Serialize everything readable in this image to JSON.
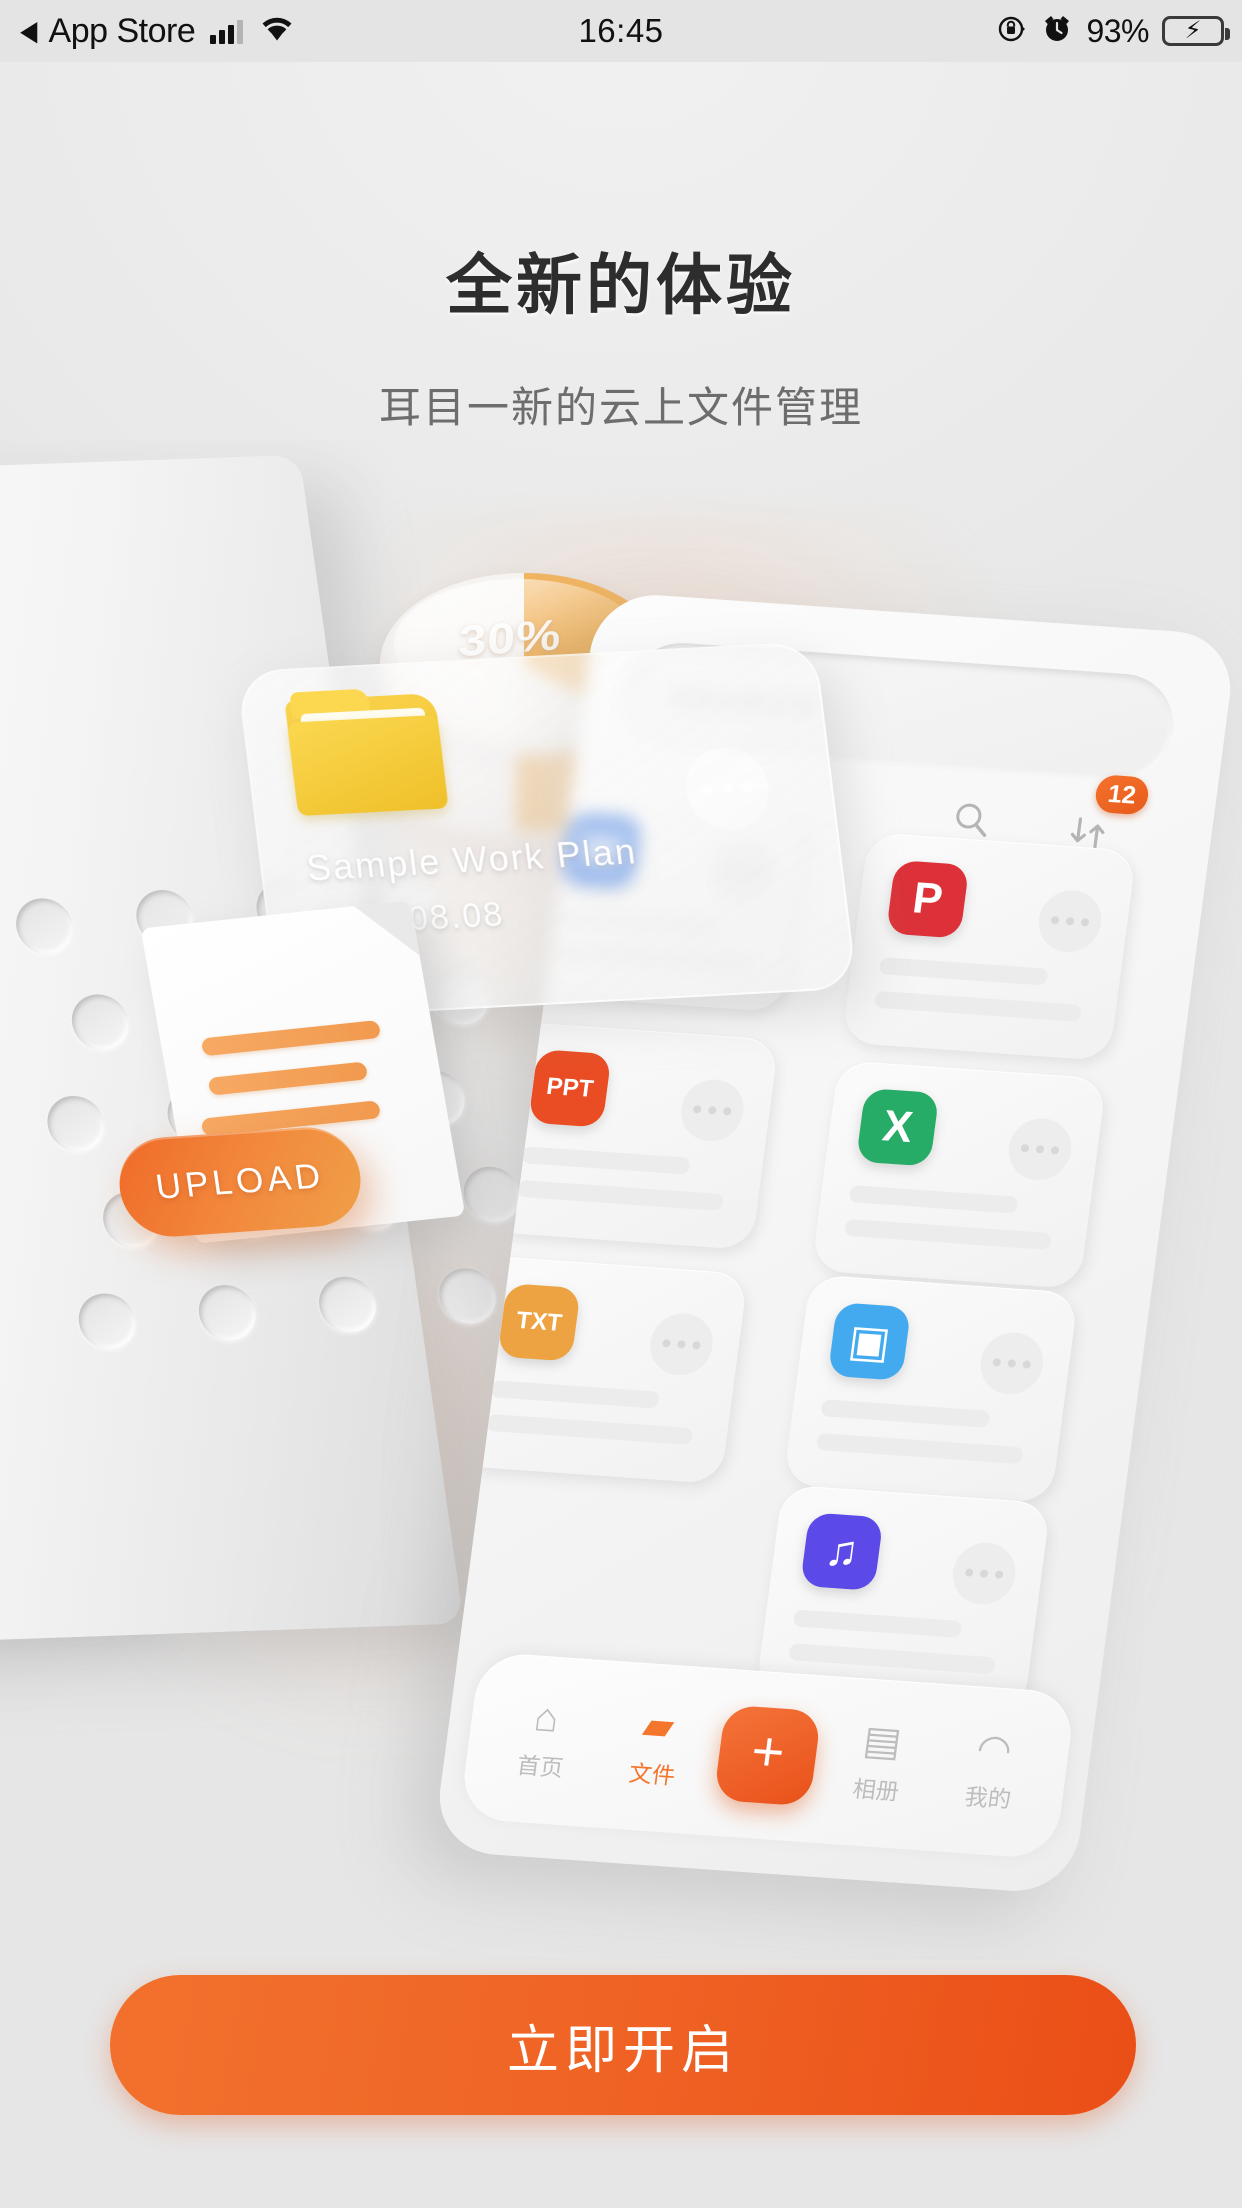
{
  "status_bar": {
    "back_label": "App Store",
    "back_icon": "triangle-left-icon",
    "signal_icon": "cellular-signal-icon",
    "wifi_icon": "wifi-icon",
    "time": "16:45",
    "rotation_lock_icon": "rotation-lock-icon",
    "alarm_icon": "alarm-clock-icon",
    "battery_percent": "93%",
    "battery_icon": "battery-charging-icon",
    "battery_level": 93,
    "charging_icon": "lightning-bolt-icon"
  },
  "header": {
    "title": "全新的体验",
    "subtitle": "耳目一新的云上文件管理"
  },
  "illustration": {
    "pie_chart": {
      "label": "30%",
      "value": 30,
      "slice_color": "#f3b45c"
    },
    "folder_card": {
      "name": "Sample Work Plan",
      "date": "2020.08.08",
      "folder_icon": "folder-icon",
      "more_icon": "more-dots-icon"
    },
    "document": {
      "doc_icon": "document-icon",
      "line_color": "#f4a05a"
    },
    "upload_button": {
      "label": "UPLOAD"
    },
    "phone": {
      "search": {
        "placeholder": "SEARCH",
        "search_icon": "magnifier-icon"
      },
      "sort": {
        "icon": "sort-icon",
        "badge": "12"
      },
      "tiles": [
        {
          "icon": "word-icon",
          "glyph": "W",
          "color": "#2b6fe0"
        },
        {
          "icon": "pdf-icon",
          "glyph": "P",
          "color": "#dc3138"
        },
        {
          "icon": "excel-icon",
          "glyph": "X",
          "color": "#27ac68"
        },
        {
          "icon": "ppt-icon",
          "glyph": "PPT",
          "color": "#ea4c23"
        },
        {
          "icon": "image-icon",
          "glyph": "▣",
          "color": "#44aaf0"
        },
        {
          "icon": "txt-icon",
          "glyph": "TXT",
          "color": "#eea343"
        },
        {
          "icon": "music-icon",
          "glyph": "♫",
          "color": "#5b4ae8"
        }
      ],
      "nav": [
        {
          "label": "首页",
          "icon": "home-icon",
          "glyph": "⌂",
          "active": false
        },
        {
          "label": "文件",
          "icon": "folder-icon",
          "glyph": "▰",
          "active": true
        },
        {
          "label": "相册",
          "icon": "album-icon",
          "glyph": "▤",
          "active": false
        },
        {
          "label": "我的",
          "icon": "profile-icon",
          "glyph": "◠",
          "active": false
        }
      ],
      "add_button": {
        "label": "+",
        "icon": "plus-icon"
      }
    }
  },
  "cta": {
    "label": "立即开启"
  },
  "colors": {
    "accent": "#ef6224",
    "accent_light": "#f2873c",
    "background": "#e8e8e8",
    "title": "#2d2d2d",
    "subtitle": "#6d6d6d"
  }
}
